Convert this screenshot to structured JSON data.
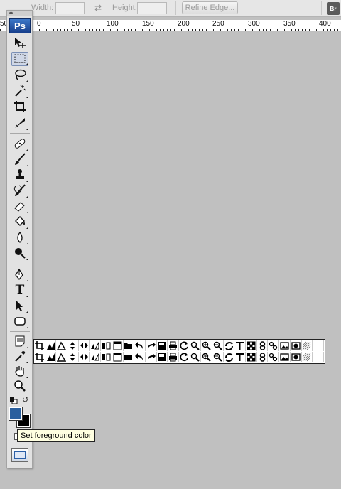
{
  "options_bar": {
    "width_label": "Width:",
    "height_label": "Height:",
    "refine_edge_label": "Refine Edge...",
    "bridge_label": "Br"
  },
  "ruler": {
    "labels": [
      "50",
      "0",
      "50",
      "100",
      "150",
      "200",
      "250",
      "300",
      "350",
      "400"
    ]
  },
  "tools_panel": {
    "logo": "Ps",
    "tools": [
      "move-tool",
      "rectangular-marquee-tool",
      "lasso-tool",
      "magic-wand-tool",
      "crop-tool",
      "slice-tool",
      "spot-healing-brush-tool",
      "brush-tool",
      "clone-stamp-tool",
      "history-brush-tool",
      "eraser-tool",
      "paint-bucket-tool",
      "blur-tool",
      "dodge-tool",
      "pen-tool",
      "type-tool",
      "path-selection-tool",
      "rectangle-tool",
      "notes-tool",
      "eyedropper-tool",
      "hand-tool",
      "zoom-tool"
    ],
    "type_tool_glyph": "T",
    "foreground_color": "#2a5f9e",
    "background_color": "#000000"
  },
  "tooltip": {
    "text": "Set foreground color"
  },
  "floating_strip": {
    "rows": 2,
    "icons": [
      "crop-icon",
      "chart-icon",
      "transform-icon",
      "flip-vertical-icon",
      "flip-horizontal-icon",
      "align-icon",
      "columns-icon",
      "window-icon",
      "open-folder-icon",
      "undo-icon",
      "redo-icon",
      "save-icon",
      "print-icon",
      "refresh-icon",
      "zoom-icon",
      "zoom-in-icon",
      "zoom-out-icon",
      "rotate-icon",
      "text-icon",
      "checker-icon",
      "link-icon",
      "chain-icon",
      "photo-icon",
      "mask-icon",
      "grid-icon",
      "blank-icon"
    ]
  }
}
